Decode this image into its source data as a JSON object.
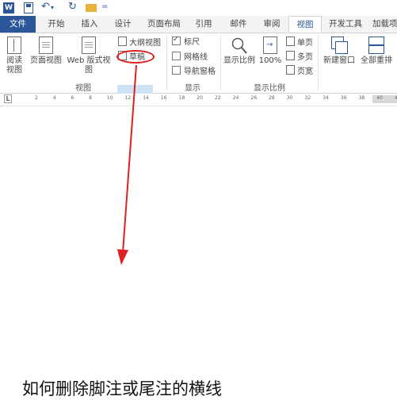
{
  "quick_access": {
    "word_icon": "W",
    "undo": "↶",
    "undo_dd": "▾",
    "redo": "↻",
    "more": "="
  },
  "tabs": [
    {
      "label": "文件"
    },
    {
      "label": "开始"
    },
    {
      "label": "插入"
    },
    {
      "label": "设计"
    },
    {
      "label": "页面布局"
    },
    {
      "label": "引用"
    },
    {
      "label": "邮件"
    },
    {
      "label": "审阅"
    },
    {
      "label": "视图"
    },
    {
      "label": "开发工具"
    },
    {
      "label": "加载项"
    }
  ],
  "ribbon": {
    "views": {
      "read_l1": "阅读",
      "read_l2": "视图",
      "page": "页面视图",
      "web": "Web 版式视图",
      "outline": "大纲视图",
      "draft": "草稿",
      "group": "视图"
    },
    "show": {
      "ruler": "标尺",
      "grid": "网格线",
      "nav": "导航窗格",
      "group": "显示"
    },
    "zoom": {
      "zoom": "显示比例",
      "hundred": "100%",
      "one": "单页",
      "multi": "多页",
      "width": "页宽",
      "group": "显示比例"
    },
    "window": {
      "new": "新建窗口",
      "arrange": "全部重排"
    }
  },
  "ruler": {
    "marker": "L",
    "ticks": [
      "2",
      "4",
      "6",
      "8",
      "10",
      "12",
      "14",
      "16",
      "18",
      "20",
      "22",
      "24",
      "26",
      "28",
      "30",
      "32",
      "34",
      "36",
      "38",
      "40",
      "42"
    ]
  },
  "caption": "如何删除脚注或尾注的横线",
  "colors": {
    "accent": "#2b579a",
    "highlight": "#e02020"
  }
}
